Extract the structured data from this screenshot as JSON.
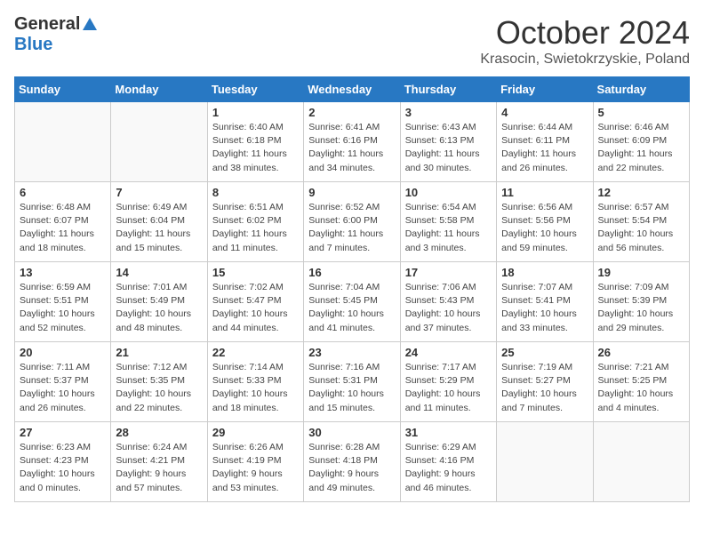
{
  "logo": {
    "general": "General",
    "blue": "Blue"
  },
  "title": "October 2024",
  "location": "Krasocin, Swietokrzyskie, Poland",
  "days_of_week": [
    "Sunday",
    "Monday",
    "Tuesday",
    "Wednesday",
    "Thursday",
    "Friday",
    "Saturday"
  ],
  "weeks": [
    [
      {
        "day": "",
        "detail": ""
      },
      {
        "day": "",
        "detail": ""
      },
      {
        "day": "1",
        "detail": "Sunrise: 6:40 AM\nSunset: 6:18 PM\nDaylight: 11 hours\nand 38 minutes."
      },
      {
        "day": "2",
        "detail": "Sunrise: 6:41 AM\nSunset: 6:16 PM\nDaylight: 11 hours\nand 34 minutes."
      },
      {
        "day": "3",
        "detail": "Sunrise: 6:43 AM\nSunset: 6:13 PM\nDaylight: 11 hours\nand 30 minutes."
      },
      {
        "day": "4",
        "detail": "Sunrise: 6:44 AM\nSunset: 6:11 PM\nDaylight: 11 hours\nand 26 minutes."
      },
      {
        "day": "5",
        "detail": "Sunrise: 6:46 AM\nSunset: 6:09 PM\nDaylight: 11 hours\nand 22 minutes."
      }
    ],
    [
      {
        "day": "6",
        "detail": "Sunrise: 6:48 AM\nSunset: 6:07 PM\nDaylight: 11 hours\nand 18 minutes."
      },
      {
        "day": "7",
        "detail": "Sunrise: 6:49 AM\nSunset: 6:04 PM\nDaylight: 11 hours\nand 15 minutes."
      },
      {
        "day": "8",
        "detail": "Sunrise: 6:51 AM\nSunset: 6:02 PM\nDaylight: 11 hours\nand 11 minutes."
      },
      {
        "day": "9",
        "detail": "Sunrise: 6:52 AM\nSunset: 6:00 PM\nDaylight: 11 hours\nand 7 minutes."
      },
      {
        "day": "10",
        "detail": "Sunrise: 6:54 AM\nSunset: 5:58 PM\nDaylight: 11 hours\nand 3 minutes."
      },
      {
        "day": "11",
        "detail": "Sunrise: 6:56 AM\nSunset: 5:56 PM\nDaylight: 10 hours\nand 59 minutes."
      },
      {
        "day": "12",
        "detail": "Sunrise: 6:57 AM\nSunset: 5:54 PM\nDaylight: 10 hours\nand 56 minutes."
      }
    ],
    [
      {
        "day": "13",
        "detail": "Sunrise: 6:59 AM\nSunset: 5:51 PM\nDaylight: 10 hours\nand 52 minutes."
      },
      {
        "day": "14",
        "detail": "Sunrise: 7:01 AM\nSunset: 5:49 PM\nDaylight: 10 hours\nand 48 minutes."
      },
      {
        "day": "15",
        "detail": "Sunrise: 7:02 AM\nSunset: 5:47 PM\nDaylight: 10 hours\nand 44 minutes."
      },
      {
        "day": "16",
        "detail": "Sunrise: 7:04 AM\nSunset: 5:45 PM\nDaylight: 10 hours\nand 41 minutes."
      },
      {
        "day": "17",
        "detail": "Sunrise: 7:06 AM\nSunset: 5:43 PM\nDaylight: 10 hours\nand 37 minutes."
      },
      {
        "day": "18",
        "detail": "Sunrise: 7:07 AM\nSunset: 5:41 PM\nDaylight: 10 hours\nand 33 minutes."
      },
      {
        "day": "19",
        "detail": "Sunrise: 7:09 AM\nSunset: 5:39 PM\nDaylight: 10 hours\nand 29 minutes."
      }
    ],
    [
      {
        "day": "20",
        "detail": "Sunrise: 7:11 AM\nSunset: 5:37 PM\nDaylight: 10 hours\nand 26 minutes."
      },
      {
        "day": "21",
        "detail": "Sunrise: 7:12 AM\nSunset: 5:35 PM\nDaylight: 10 hours\nand 22 minutes."
      },
      {
        "day": "22",
        "detail": "Sunrise: 7:14 AM\nSunset: 5:33 PM\nDaylight: 10 hours\nand 18 minutes."
      },
      {
        "day": "23",
        "detail": "Sunrise: 7:16 AM\nSunset: 5:31 PM\nDaylight: 10 hours\nand 15 minutes."
      },
      {
        "day": "24",
        "detail": "Sunrise: 7:17 AM\nSunset: 5:29 PM\nDaylight: 10 hours\nand 11 minutes."
      },
      {
        "day": "25",
        "detail": "Sunrise: 7:19 AM\nSunset: 5:27 PM\nDaylight: 10 hours\nand 7 minutes."
      },
      {
        "day": "26",
        "detail": "Sunrise: 7:21 AM\nSunset: 5:25 PM\nDaylight: 10 hours\nand 4 minutes."
      }
    ],
    [
      {
        "day": "27",
        "detail": "Sunrise: 6:23 AM\nSunset: 4:23 PM\nDaylight: 10 hours\nand 0 minutes."
      },
      {
        "day": "28",
        "detail": "Sunrise: 6:24 AM\nSunset: 4:21 PM\nDaylight: 9 hours\nand 57 minutes."
      },
      {
        "day": "29",
        "detail": "Sunrise: 6:26 AM\nSunset: 4:19 PM\nDaylight: 9 hours\nand 53 minutes."
      },
      {
        "day": "30",
        "detail": "Sunrise: 6:28 AM\nSunset: 4:18 PM\nDaylight: 9 hours\nand 49 minutes."
      },
      {
        "day": "31",
        "detail": "Sunrise: 6:29 AM\nSunset: 4:16 PM\nDaylight: 9 hours\nand 46 minutes."
      },
      {
        "day": "",
        "detail": ""
      },
      {
        "day": "",
        "detail": ""
      }
    ]
  ]
}
